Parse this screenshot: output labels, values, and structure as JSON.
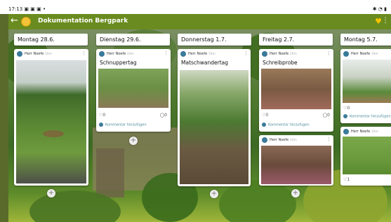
{
  "status": {
    "time": "17:13",
    "left_icons": "▣ ▣ ▣ •",
    "right_icons": "✱ ◔ ▮"
  },
  "app": {
    "title": "Dokumentation Bergpark",
    "back_icon": "←",
    "heart_icon": "♥",
    "more_icon": "⋮",
    "accent": "#6a8b1f"
  },
  "columns": [
    {
      "date": "Montag 28.6.",
      "cards": [
        {
          "author": "Herr Noefe",
          "time": "10m",
          "title": "",
          "likes": "",
          "comments": "",
          "comment_label": ""
        }
      ]
    },
    {
      "date": "Dienstag 29.6.",
      "cards": [
        {
          "author": "Herr Noefe",
          "time": "10m",
          "title": "Schnuppertag",
          "likes": "0",
          "comments": "0",
          "comment_label": "Kommentar hinzufügen"
        }
      ]
    },
    {
      "date": "Donnerstag 1.7.",
      "cards": [
        {
          "author": "Herr Noefe",
          "time": "10m",
          "title": "Matschwandertag",
          "likes": "",
          "comments": "",
          "comment_label": ""
        }
      ]
    },
    {
      "date": "Freitag 2.7.",
      "cards": [
        {
          "author": "Herr Noefe",
          "time": "10m",
          "title": "Schreibprobe",
          "likes": "0",
          "comments": "0",
          "comment_label": "Kommentar hinzufügen"
        },
        {
          "author": "Herr Noefe",
          "time": "10m",
          "title": "",
          "likes": "",
          "comments": "",
          "comment_label": ""
        }
      ]
    },
    {
      "date": "Montag 5.7.",
      "cards": [
        {
          "author": "Herr Noefe",
          "time": "10m",
          "title": "",
          "likes": "0",
          "comments": "",
          "comment_label": "Kommentar hinzufügen"
        },
        {
          "author": "Herr Noefe",
          "time": "10m",
          "title": "",
          "likes": "1",
          "comments": "",
          "comment_label": ""
        }
      ]
    }
  ],
  "add_label": "+",
  "kebab_icon": "⋮",
  "heart_outline": "♡",
  "comment_icon": "◯"
}
